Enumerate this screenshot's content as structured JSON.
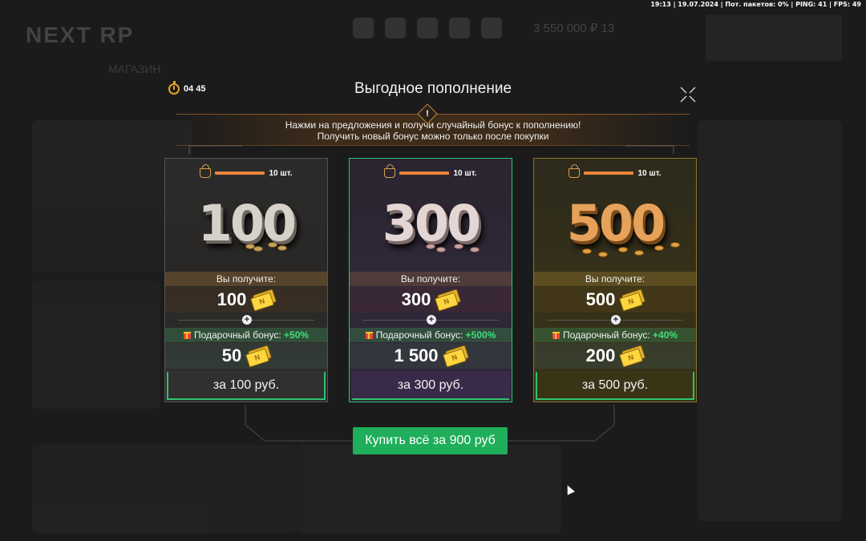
{
  "status_bar": {
    "text": "19:13 | 19.07.2024 | Пот. пакетов: 0% | PING: 41 | FPS: 49"
  },
  "background": {
    "logo": "NEXT RP",
    "shop_tab": "МАГАЗИН",
    "balance": "3 550 000 ₽  13"
  },
  "modal": {
    "title": "Выгодное пополнение",
    "timer": "04 45",
    "notice_line1": "Нажми на предложения и получи случайный бонус к пополнению!",
    "notice_line2": "Получить новый бонус можно только после покупки",
    "notice_icon": "!",
    "buy_all_label": "Купить всё за 900 руб",
    "plus_symbol": "+"
  },
  "offers": [
    {
      "hero": "100",
      "stock": "10 шт.",
      "stock_fraction": 1.0,
      "receive_label": "Вы получите:",
      "receive_amount": "100",
      "bonus_label": "Подарочный бонус:",
      "bonus_percent": "+50%",
      "bonus_amount": "50",
      "price_label": "за 100 руб."
    },
    {
      "hero": "300",
      "stock": "10 шт.",
      "stock_fraction": 1.0,
      "receive_label": "Вы получите:",
      "receive_amount": "300",
      "bonus_label": "Подарочный бонус:",
      "bonus_percent": "+500%",
      "bonus_amount": "1 500",
      "price_label": "за 300 руб."
    },
    {
      "hero": "500",
      "stock": "10 шт.",
      "stock_fraction": 1.0,
      "receive_label": "Вы получите:",
      "receive_amount": "500",
      "bonus_label": "Подарочный бонус:",
      "bonus_percent": "+40%",
      "bonus_amount": "200",
      "price_label": "за 500 руб."
    }
  ],
  "icons": {
    "timer": "stopwatch-icon",
    "close": "close-icon",
    "basket": "basket-icon",
    "currency": "ticket-icon",
    "gift": "gift-icon",
    "notice": "exclamation-icon"
  },
  "colors": {
    "accent_green": "#1fae5a",
    "bonus_green": "#3fe07b",
    "stock_bar": "#e9853b",
    "timer_gold": "#e4a52a"
  }
}
